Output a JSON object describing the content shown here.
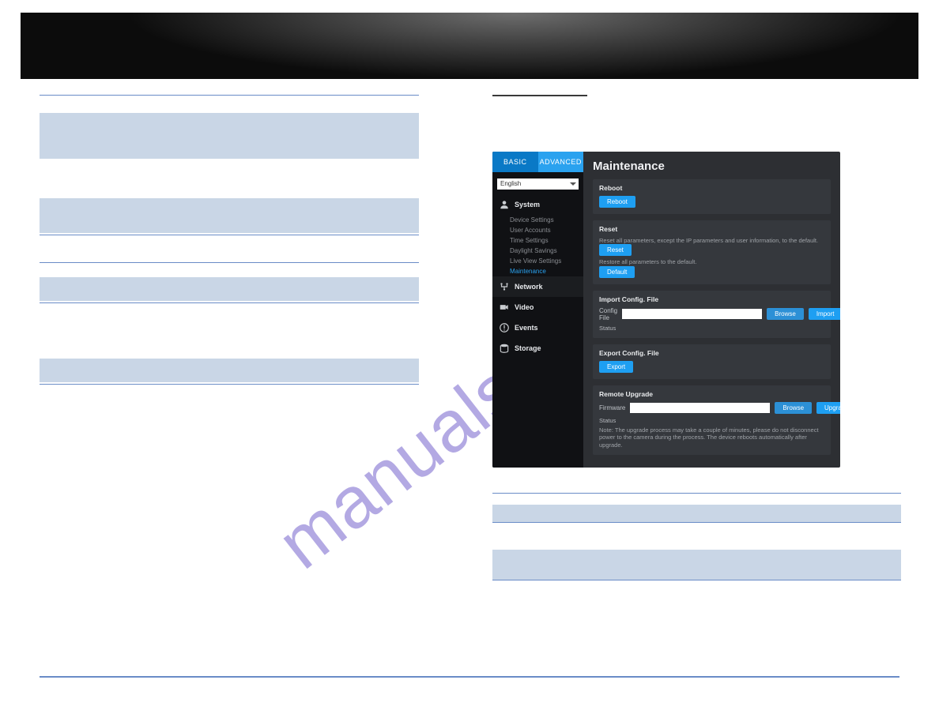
{
  "watermark": "manualshiv..com",
  "screenshot": {
    "tabs": {
      "basic": "BASIC",
      "advanced": "ADVANCED"
    },
    "language": "English",
    "sidebar": {
      "system": {
        "title": "System",
        "items": [
          "Device Settings",
          "User Accounts",
          "Time Settings",
          "Daylight Savings",
          "Live View Settings",
          "Maintenance"
        ]
      },
      "network": "Network",
      "video": "Video",
      "events": "Events",
      "storage": "Storage"
    },
    "title": "Maintenance",
    "sections": {
      "reboot": {
        "heading": "Reboot",
        "button": "Reboot"
      },
      "reset": {
        "heading": "Reset",
        "line1": "Reset all parameters, except the IP parameters and user information, to the default.",
        "btn1": "Reset",
        "line2": "Restore all parameters to the default.",
        "btn2": "Default"
      },
      "import": {
        "heading": "Import Config. File",
        "field_label": "Config File",
        "browse": "Browse",
        "import": "Import",
        "status_label": "Status"
      },
      "export": {
        "heading": "Export Config. File",
        "button": "Export"
      },
      "upgrade": {
        "heading": "Remote Upgrade",
        "field_label": "Firmware",
        "browse": "Browse",
        "upgrade": "Upgrade",
        "status_label": "Status",
        "note": "Note: The upgrade process may take a couple of minutes, please do not disconnect power to the camera during the process. The device reboots automatically after upgrade."
      }
    }
  }
}
